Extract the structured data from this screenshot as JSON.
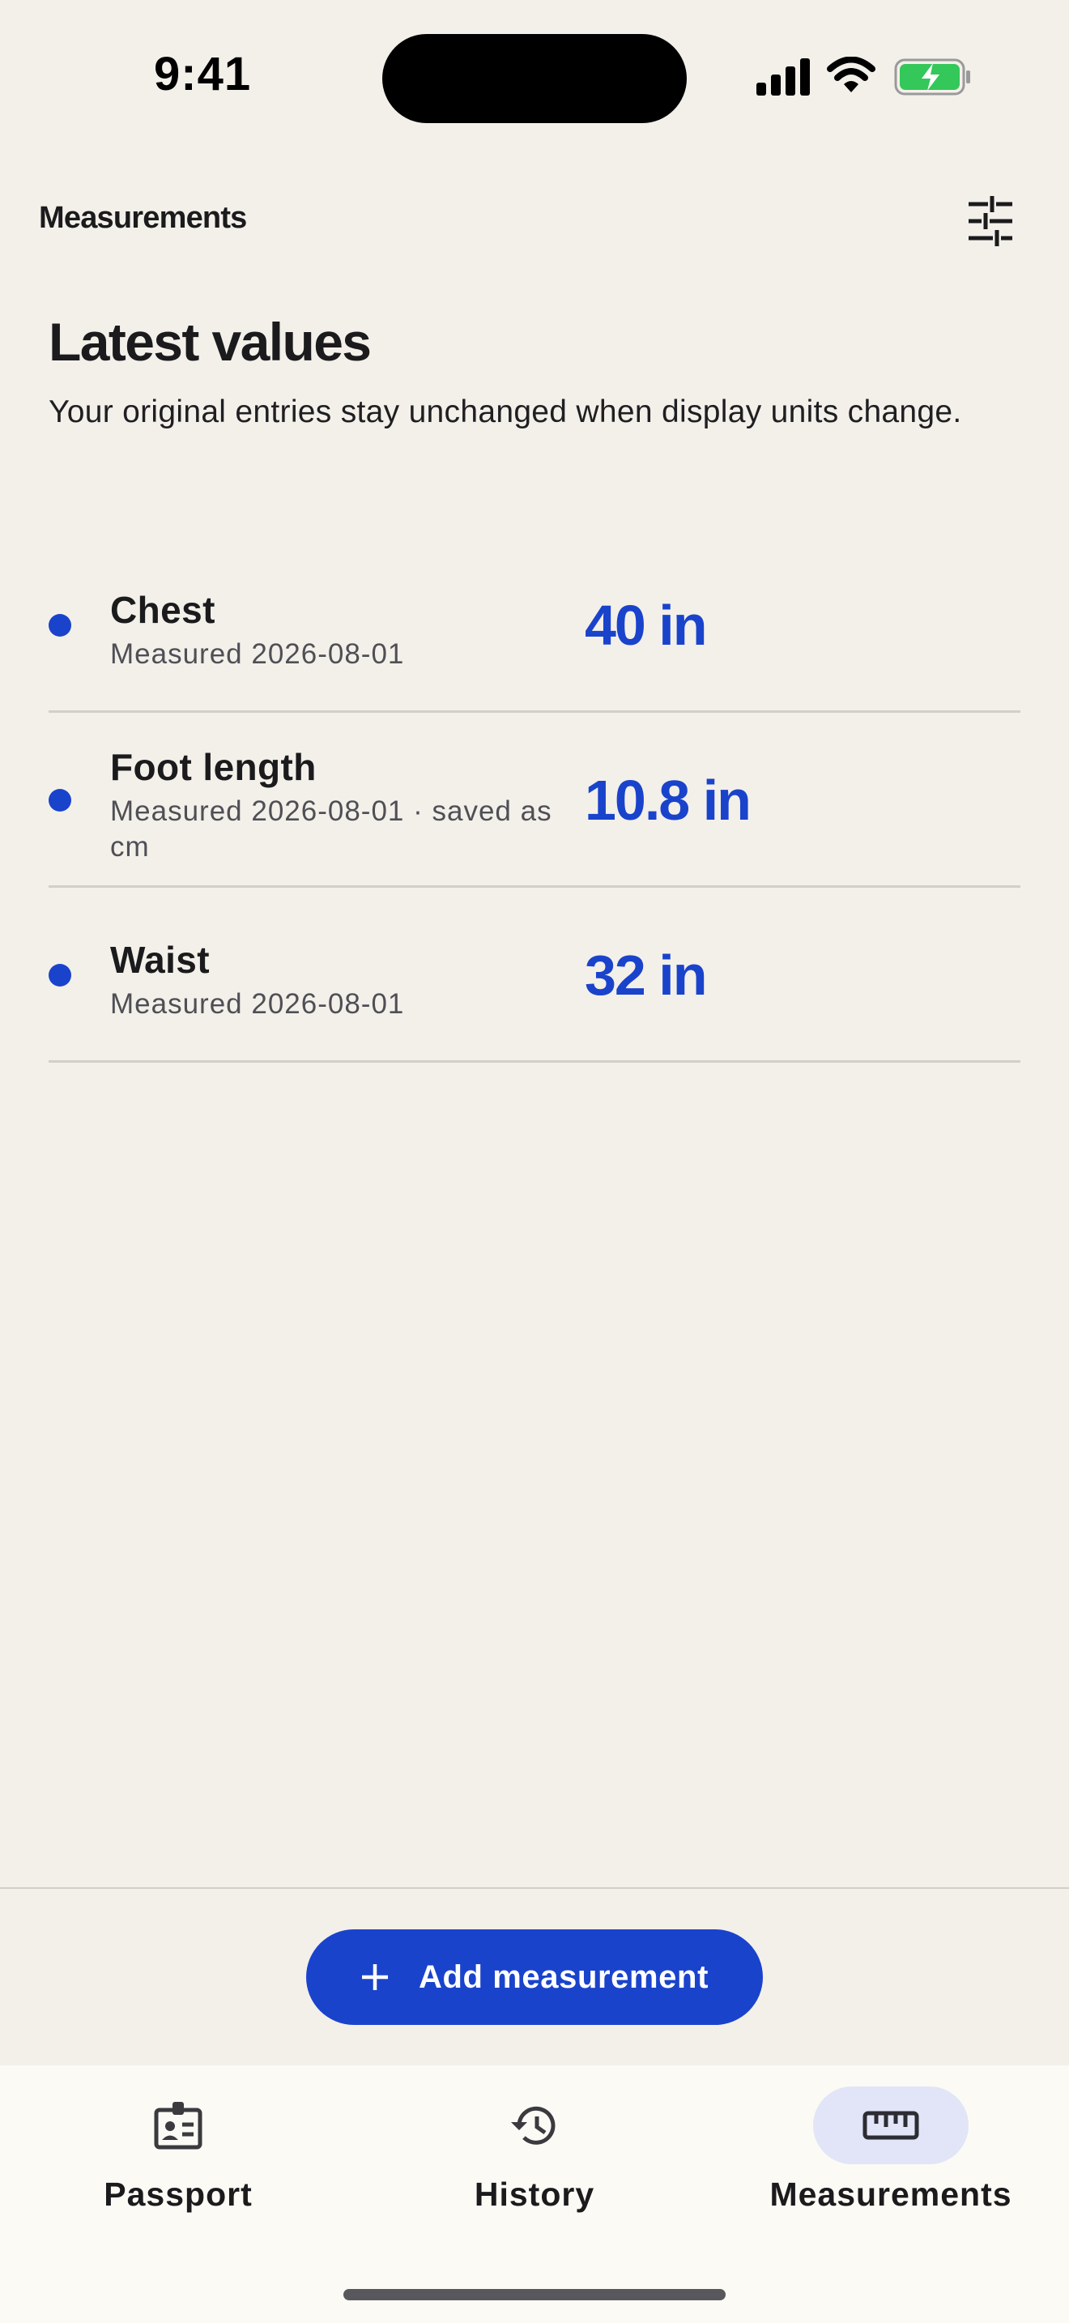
{
  "status_bar": {
    "time": "9:41"
  },
  "header": {
    "title": "Measurements",
    "filter_icon": "sliders-icon"
  },
  "intro": {
    "title": "Latest values",
    "subtitle": "Your original entries stay unchanged when display units change."
  },
  "measurements": [
    {
      "name": "Chest",
      "meta": "Measured 2026-08-01",
      "value": "40 in"
    },
    {
      "name": "Foot length",
      "meta": "Measured 2026-08-01 · saved as cm",
      "value": "10.8 in"
    },
    {
      "name": "Waist",
      "meta": "Measured 2026-08-01",
      "value": "32 in"
    }
  ],
  "actions": {
    "add_label": "Add measurement",
    "add_icon": "plus-icon"
  },
  "tabs": [
    {
      "label": "Passport",
      "icon": "id-badge-icon",
      "active": false
    },
    {
      "label": "History",
      "icon": "history-icon",
      "active": false
    },
    {
      "label": "Measurements",
      "icon": "ruler-icon",
      "active": true
    }
  ],
  "colors": {
    "accent": "#1a43cc",
    "background": "#f3f0ea",
    "tab_active_bg": "#e1e5f7",
    "battery": "#34c759"
  }
}
